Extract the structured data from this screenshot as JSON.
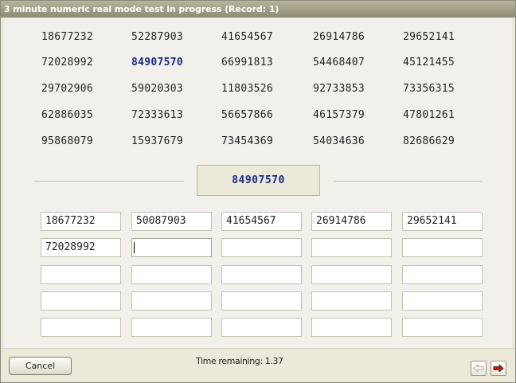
{
  "window": {
    "title": "3 minute numeric real mode test in progress (Record: 1)"
  },
  "number_grid": {
    "rows": [
      [
        "18677232",
        "52287903",
        "41654567",
        "26914786",
        "29652141"
      ],
      [
        "72028992",
        "84907570",
        "66991813",
        "54468407",
        "45121455"
      ],
      [
        "29702906",
        "59020303",
        "11803526",
        "92733853",
        "73356315"
      ],
      [
        "62886035",
        "72333613",
        "56657866",
        "46157379",
        "47801261"
      ],
      [
        "95868079",
        "15937679",
        "73454369",
        "54034636",
        "82686629"
      ]
    ],
    "highlighted": {
      "row": 1,
      "col": 1
    }
  },
  "current_target": "84907570",
  "answers": {
    "rows": [
      [
        "18677232",
        "50087903",
        "41654567",
        "26914786",
        "29652141"
      ],
      [
        "72028992",
        "",
        "",
        "",
        ""
      ],
      [
        "",
        "",
        "",
        "",
        ""
      ],
      [
        "",
        "",
        "",
        "",
        ""
      ],
      [
        "",
        "",
        "",
        "",
        ""
      ]
    ],
    "focused": {
      "row": 1,
      "col": 1
    }
  },
  "footer": {
    "cancel_label": "Cancel",
    "time_remaining": "Time remaining: 1.37"
  },
  "colors": {
    "highlight": "#1a2a8a",
    "back_arrow": "#b8b5a3",
    "next_arrow": "#cc1111"
  },
  "icons": {
    "back": "arrow-left-icon",
    "next": "arrow-right-icon"
  }
}
